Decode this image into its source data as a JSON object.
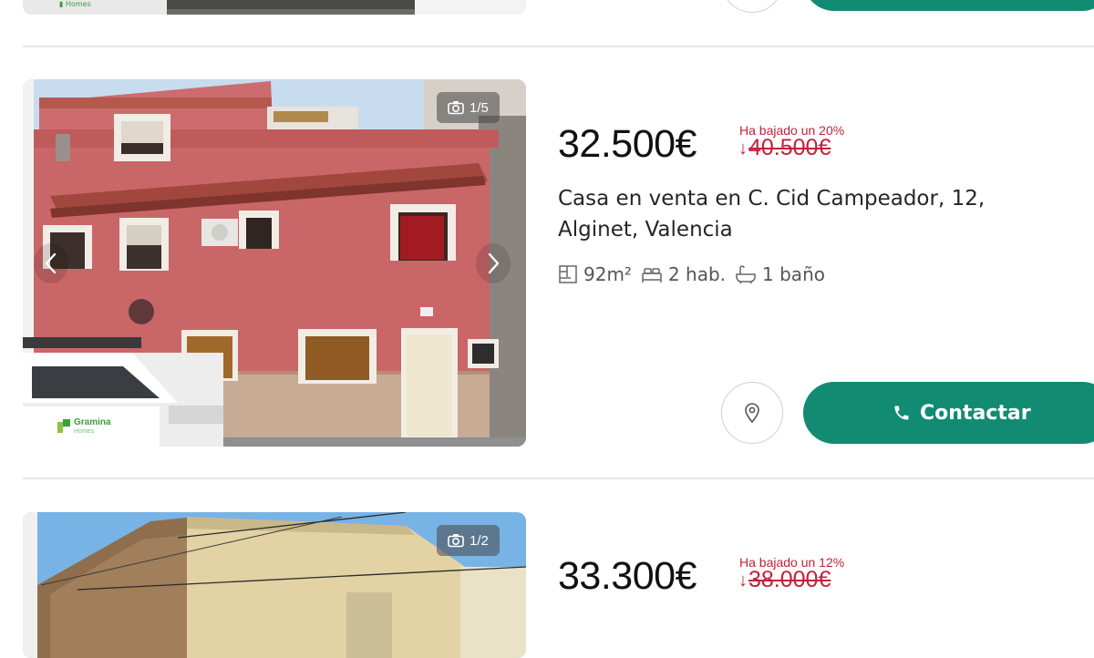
{
  "listings": [
    {
      "photo_counter": "",
      "price": "",
      "discount_label": "",
      "old_price": "",
      "title": "",
      "area": "",
      "rooms": "",
      "baths": "",
      "contact_label": ""
    },
    {
      "photo_counter": "1/5",
      "price": "32.500€",
      "discount_label": "Ha bajado un 20%",
      "old_price": "40.500€",
      "title": "Casa en venta en C. Cid Campeador, 12, Alginet, Valencia",
      "area": "92m²",
      "rooms": "2 hab.",
      "baths": "1 baño",
      "contact_label": "Contactar",
      "logo_text": "Gramina",
      "logo_sub": "Homes"
    },
    {
      "photo_counter": "1/2",
      "price": "33.300€",
      "discount_label": "Ha bajado un 12%",
      "old_price": "38.000€"
    }
  ],
  "icons": {
    "camera": "camera-icon",
    "prev": "chevron-left-icon",
    "next": "chevron-right-icon",
    "map": "map-pin-icon",
    "phone": "phone-icon",
    "area": "floorplan-icon",
    "bed": "bed-icon",
    "bath": "bathtub-icon"
  },
  "colors": {
    "accent": "#128b73",
    "discount": "#c2213a",
    "divider": "#e6e6e6"
  }
}
